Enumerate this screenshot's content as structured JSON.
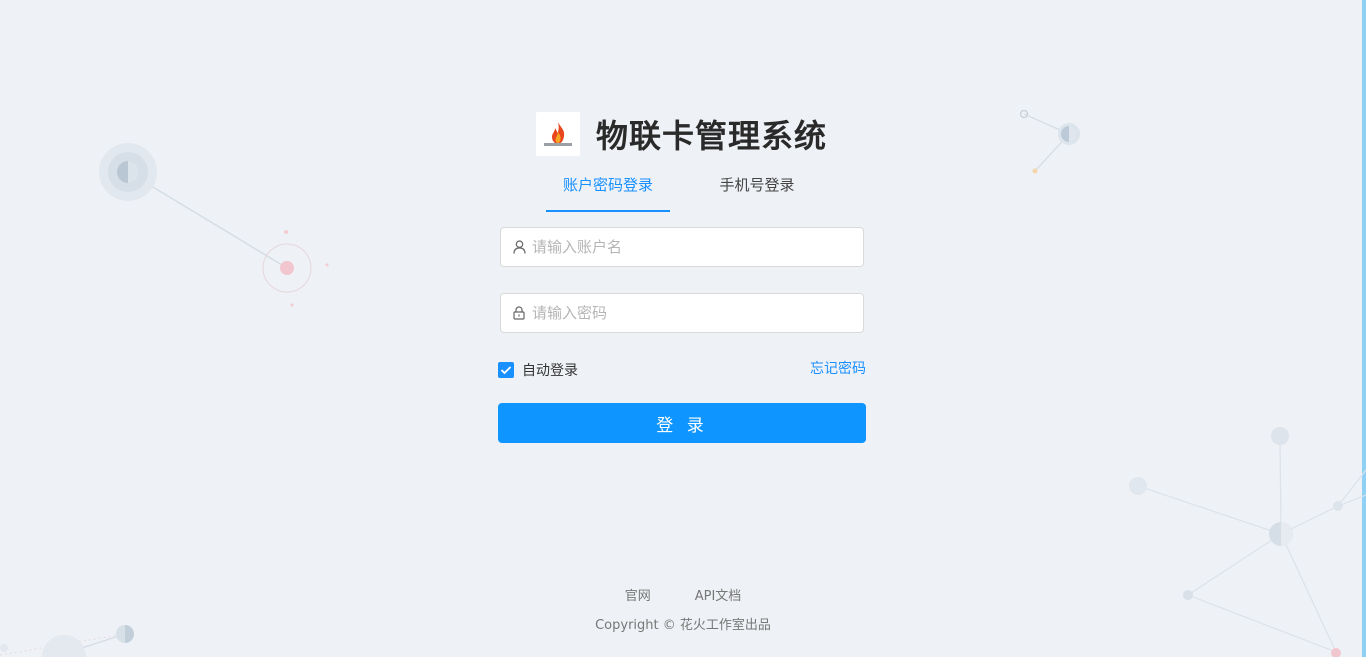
{
  "header": {
    "logo_name": "spark-flame-logo",
    "title": "物联卡管理系统"
  },
  "tabs": [
    {
      "label": "账户密码登录",
      "active": true
    },
    {
      "label": "手机号登录",
      "active": false
    }
  ],
  "form": {
    "username": {
      "placeholder": "请输入账户名",
      "value": "",
      "icon": "user-icon"
    },
    "password": {
      "placeholder": "请输入密码",
      "value": "",
      "icon": "lock-icon"
    },
    "auto_login": {
      "label": "自动登录",
      "checked": true
    },
    "forgot_password": "忘记密码",
    "submit_label": "登 录"
  },
  "footer": {
    "links": [
      "官网",
      "API文档"
    ],
    "copyright": "Copyright © 花火工作室出品"
  },
  "colors": {
    "accent": "#1890ff",
    "button": "#0e95ff",
    "background": "#eef1f5"
  }
}
